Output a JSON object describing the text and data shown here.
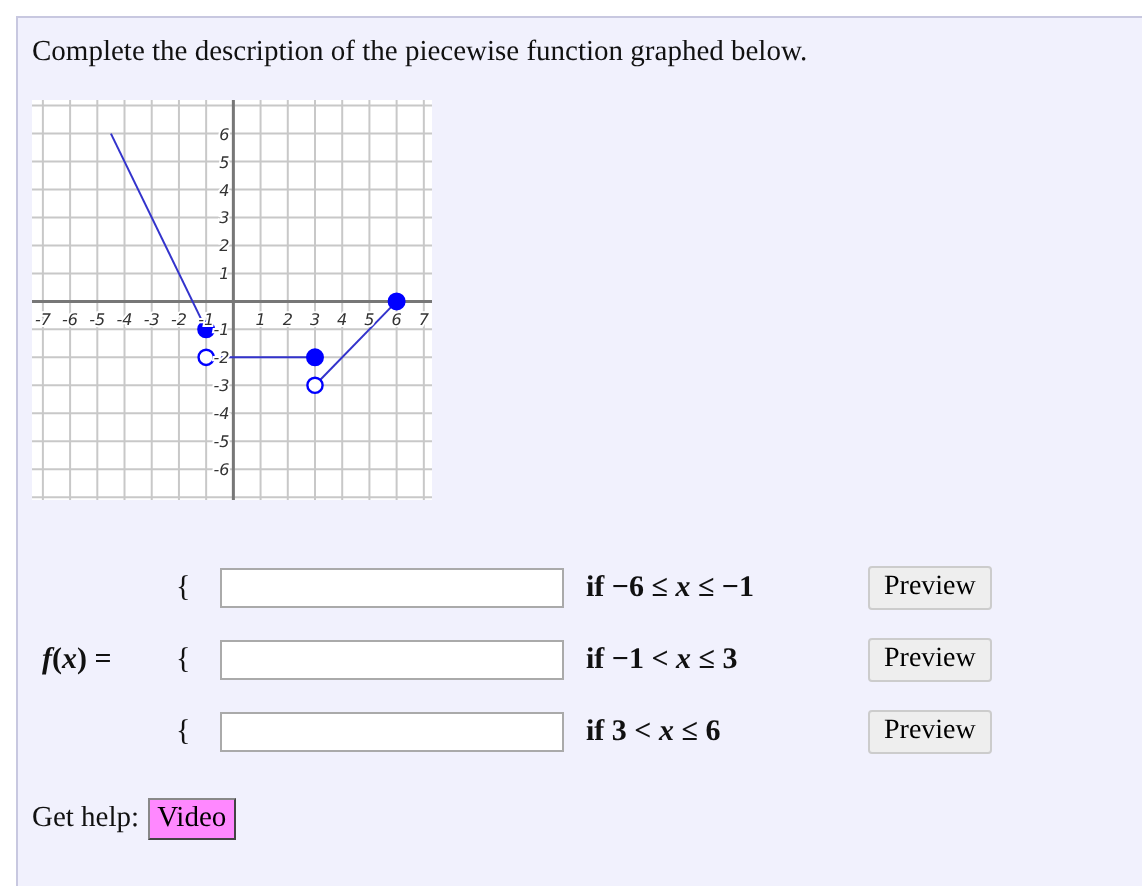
{
  "prompt": "Complete the description of the piecewise function graphed below.",
  "graph": {
    "chart_data": {
      "type": "line",
      "x": [
        -4.5,
        -1,
        3,
        6
      ],
      "xlim": [
        -7.4,
        7.3
      ],
      "grid": true,
      "ylim": [
        -7.1,
        7.2
      ],
      "xticks": [
        -7,
        -6,
        -5,
        -4,
        -3,
        -2,
        -1,
        1,
        2,
        3,
        4,
        5,
        6,
        7
      ],
      "yticks": [
        -6,
        -5,
        -4,
        -3,
        -2,
        -1,
        1,
        2,
        3,
        4,
        5,
        6
      ],
      "series": [
        {
          "color": "#3333cc",
          "values": [
            6,
            -1,
            null,
            null
          ],
          "marker": [
            "none",
            "filled",
            null,
            null
          ]
        },
        {
          "color": "#3333cc",
          "values": [
            null,
            -2,
            -2,
            null
          ],
          "marker": [
            null,
            "open",
            "filled",
            null
          ]
        },
        {
          "color": "#3333cc",
          "values": [
            null,
            null,
            -3,
            0
          ],
          "marker": [
            null,
            null,
            "open",
            "filled"
          ]
        }
      ]
    }
  },
  "function_label": "*f*(*x*) =",
  "pieces": [
    {
      "brace": "{",
      "condition": "if −6 ≤ *x* ≤  −1",
      "button": "Preview"
    },
    {
      "brace": "{",
      "condition": "if −1 < *x* ≤ 3",
      "button": "Preview"
    },
    {
      "brace": "{",
      "condition": "if 3 < *x* ≤ 6",
      "button": "Preview"
    }
  ],
  "help": {
    "label": "Get help:",
    "button": "Video"
  }
}
